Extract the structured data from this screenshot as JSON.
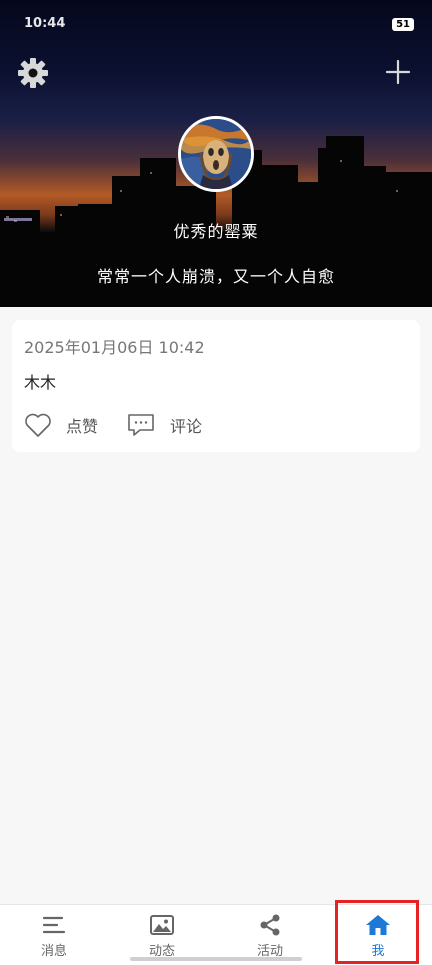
{
  "status_bar": {
    "time": "10:44",
    "battery": "51"
  },
  "profile": {
    "username": "优秀的罂粟",
    "signature": "常常一个人崩溃，又一个人自愈"
  },
  "post": {
    "timestamp": "2025年01月06日 10:42",
    "content": "木木",
    "like_label": "点赞",
    "comment_label": "评论"
  },
  "nav": {
    "messages": "消息",
    "moments": "动态",
    "activities": "活动",
    "me": "我"
  },
  "colors": {
    "accent": "#1e78d6",
    "highlight": "#e52326",
    "background": "#f7f7f7"
  },
  "icons": {
    "settings": "gear-icon",
    "add": "plus-icon",
    "like": "heart-icon",
    "comment": "comment-bubble-icon",
    "messages": "lines-icon",
    "moments": "picture-icon",
    "activities": "share-icon",
    "me": "home-icon"
  }
}
